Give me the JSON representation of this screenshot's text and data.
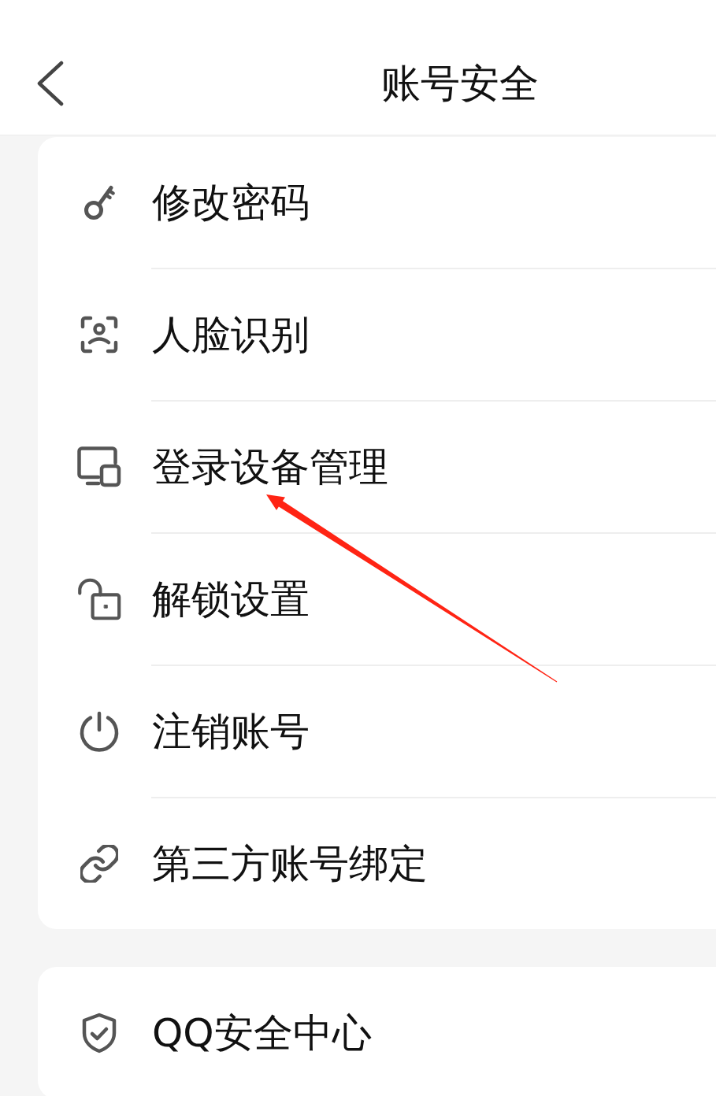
{
  "header": {
    "title": "账号安全"
  },
  "groups": [
    {
      "items": [
        {
          "label": "修改密码"
        },
        {
          "label": "人脸识别"
        },
        {
          "label": "登录设备管理"
        },
        {
          "label": "解锁设置"
        },
        {
          "label": "注销账号"
        },
        {
          "label": "第三方账号绑定"
        }
      ]
    },
    {
      "items": [
        {
          "label": "QQ安全中心"
        }
      ]
    }
  ]
}
